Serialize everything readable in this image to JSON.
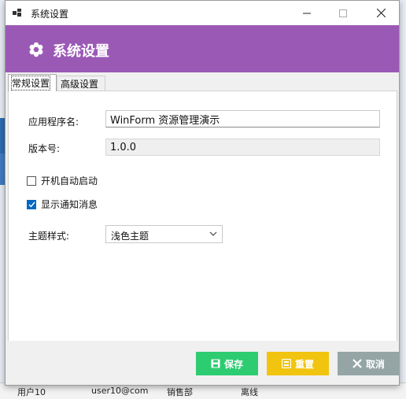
{
  "background": {
    "rows": [
      {
        "cells": [
          "用户10",
          "user10@com",
          "销售部",
          "离线"
        ]
      }
    ]
  },
  "window": {
    "title": "系统设置",
    "minimize_icon": "minimize-icon",
    "maximize_icon": "maximize-icon",
    "close_icon": "close-icon"
  },
  "header": {
    "title": "系统设置",
    "icon": "gear-icon",
    "color": "#9b59b6"
  },
  "tabs": [
    {
      "label": "常规设置",
      "active": true
    },
    {
      "label": "高级设置",
      "active": false
    }
  ],
  "form": {
    "app_name_label": "应用程序名:",
    "app_name_value": "WinForm 资源管理演示",
    "version_label": "版本号:",
    "version_value": "1.0.0",
    "autostart_label": "开机自动启动",
    "autostart_checked": false,
    "notify_label": "显示通知消息",
    "notify_checked": true,
    "theme_label": "主题样式:",
    "theme_value": "浅色主题"
  },
  "buttons": {
    "save": {
      "label": "保存",
      "color": "#2ecc71",
      "icon": "save-icon"
    },
    "reset": {
      "label": "重置",
      "color": "#f1c40f",
      "icon": "reset-icon"
    },
    "cancel": {
      "label": "取消",
      "color": "#95a5a6",
      "icon": "x-icon"
    }
  }
}
